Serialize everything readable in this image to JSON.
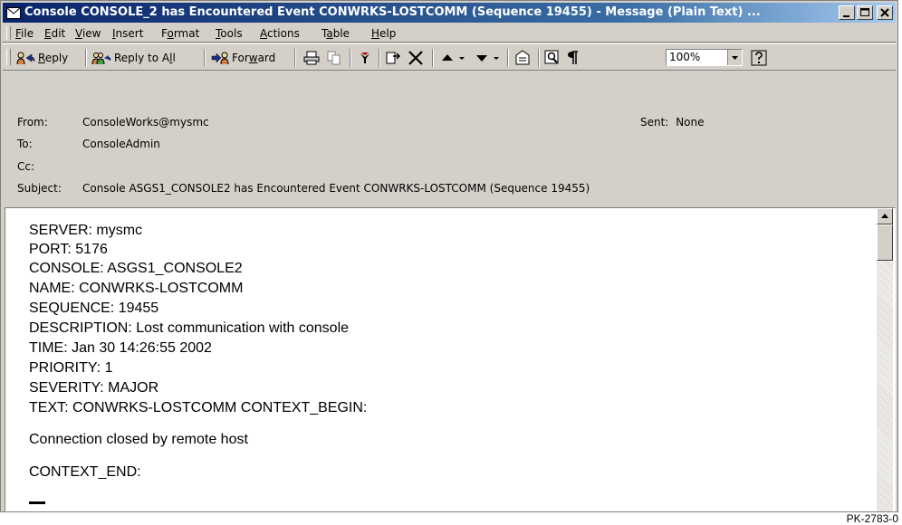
{
  "window": {
    "title": "Console CONSOLE_2 has Encountered Event CONWRKS-LOSTCOMM (Sequence 19455) - Message (Plain Text) ...",
    "colors": {
      "titlebar_start": "#0a246a",
      "titlebar_end": "#a6caf0",
      "chrome": "#d4d0c8"
    }
  },
  "menu": {
    "items": [
      {
        "label": "File",
        "mnemonic": "F",
        "rest": "ile"
      },
      {
        "label": "Edit",
        "mnemonic": "E",
        "rest": "dit"
      },
      {
        "label": "View",
        "mnemonic": "V",
        "rest": "iew"
      },
      {
        "label": "Insert",
        "mnemonic": "I",
        "rest": "nsert"
      },
      {
        "label": "Format",
        "pre": "F",
        "mnemonic": "o",
        "rest": "rmat"
      },
      {
        "label": "Tools",
        "mnemonic": "T",
        "rest": "ools"
      },
      {
        "label": "Actions",
        "mnemonic": "A",
        "rest": "ctions"
      },
      {
        "label": "Table",
        "pre": "T",
        "mnemonic": "a",
        "rest": "ble"
      },
      {
        "label": "Help",
        "mnemonic": "H",
        "rest": "elp"
      }
    ]
  },
  "toolbar": {
    "reply": {
      "mnemonic": "R",
      "rest": "eply",
      "icon": "reply-icon"
    },
    "reply_all": {
      "label": "Reply to A",
      "mnemonic": "l",
      "rest": "l",
      "icon": "reply-all-icon"
    },
    "forward": {
      "label": "For",
      "mnemonic": "w",
      "rest": "ard",
      "icon": "forward-icon"
    },
    "zoom": "100%",
    "icons": [
      "print-icon",
      "copy-icon",
      "flag-icon",
      "move-icon",
      "delete-icon",
      "previous-item-icon",
      "next-item-icon",
      "address-book-icon",
      "find-icon",
      "paragraph-icon",
      "help-icon"
    ]
  },
  "header": {
    "from_label": "From:",
    "from": "ConsoleWorks@mysmc",
    "to_label": "To:",
    "to": "ConsoleAdmin",
    "cc_label": "Cc:",
    "cc": "",
    "subject_label": "Subject:",
    "subject": "Console ASGS1_CONSOLE2 has Encountered Event CONWRKS-LOSTCOMM (Sequence 19455)",
    "sent_label": "Sent:",
    "sent": "None"
  },
  "body": {
    "lines": [
      "SERVER: mysmc",
      "PORT: 5176",
      "CONSOLE: ASGS1_CONSOLE2",
      "NAME: CONWRKS-LOSTCOMM",
      "SEQUENCE: 19455",
      "DESCRIPTION: Lost communication with console",
      "TIME: Jan 30 14:26:55 2002",
      "PRIORITY: 1",
      "SEVERITY: MAJOR",
      "TEXT: CONWRKS-LOSTCOMM CONTEXT_BEGIN:"
    ],
    "message": "Connection closed by remote host",
    "end": "CONTEXT_END:"
  },
  "figure_caption": "PK-2783-0"
}
